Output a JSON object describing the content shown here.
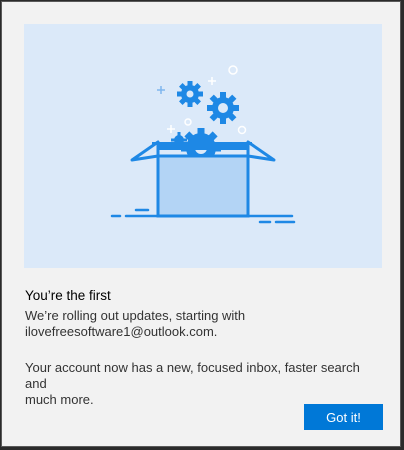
{
  "dialog": {
    "title": "You’re the first",
    "description_line1": "We’re rolling out updates, starting with",
    "description_line2": "ilovefreesoftware1@outlook.com.",
    "detail_line1": "Your account now has a new, focused inbox, faster search and",
    "detail_line2": "much more.",
    "confirm_label": "Got it!"
  },
  "illustration": {
    "icon": "open-box-with-gears-icon"
  },
  "colors": {
    "accent": "#0078d7",
    "illustration_bg": "#dbe9f9",
    "illustration_line": "#1e88e5",
    "dialog_bg": "#f2f2f2"
  }
}
